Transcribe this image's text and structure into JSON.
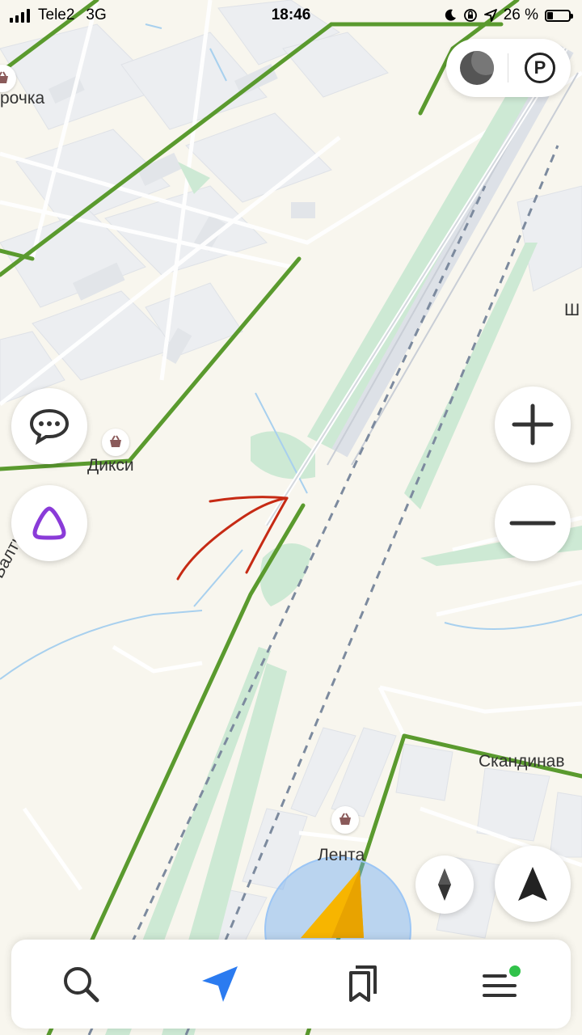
{
  "status_bar": {
    "carrier": "Tele2",
    "network": "3G",
    "time": "18:46",
    "battery": "26 %",
    "battery_level": 0.26,
    "icons": [
      "signal-icon",
      "moon-icon",
      "rotation-lock-icon",
      "location-arrow-icon",
      "battery-icon"
    ]
  },
  "top_controls": {
    "layers_icon": "layers-icon",
    "parking_icon": "parking-icon",
    "parking_letter": "P"
  },
  "map": {
    "labels": {
      "pyaterochka": "рочка",
      "diksi": "Дикси",
      "lenta": "Лента",
      "skandinav": "Скандинав",
      "baltik": "Балтик",
      "sha": "Ш"
    },
    "colors": {
      "background": "#f8f6ee",
      "traffic_green": "#5a9a2e",
      "park": "#cde9d4",
      "water": "#a8d0ee",
      "railway": "#7c8a9e",
      "annotation_arrow": "#c62a14"
    }
  },
  "left_controls": {
    "chat_icon": "chat-bubble-icon",
    "alice_icon": "alice-assistant-icon"
  },
  "right_controls": {
    "zoom_in_icon": "plus-icon",
    "zoom_out_icon": "minus-icon",
    "compass_icon": "compass-icon",
    "navigation_icon": "navigation-arrow-icon"
  },
  "tab_bar": {
    "items": [
      {
        "icon": "search-icon"
      },
      {
        "icon": "route-arrow-icon",
        "active": true
      },
      {
        "icon": "bookmarks-icon"
      },
      {
        "icon": "menu-icon",
        "notification_dot": true
      }
    ],
    "accent": "#2b7bf0",
    "dot_color": "#31c24a"
  }
}
